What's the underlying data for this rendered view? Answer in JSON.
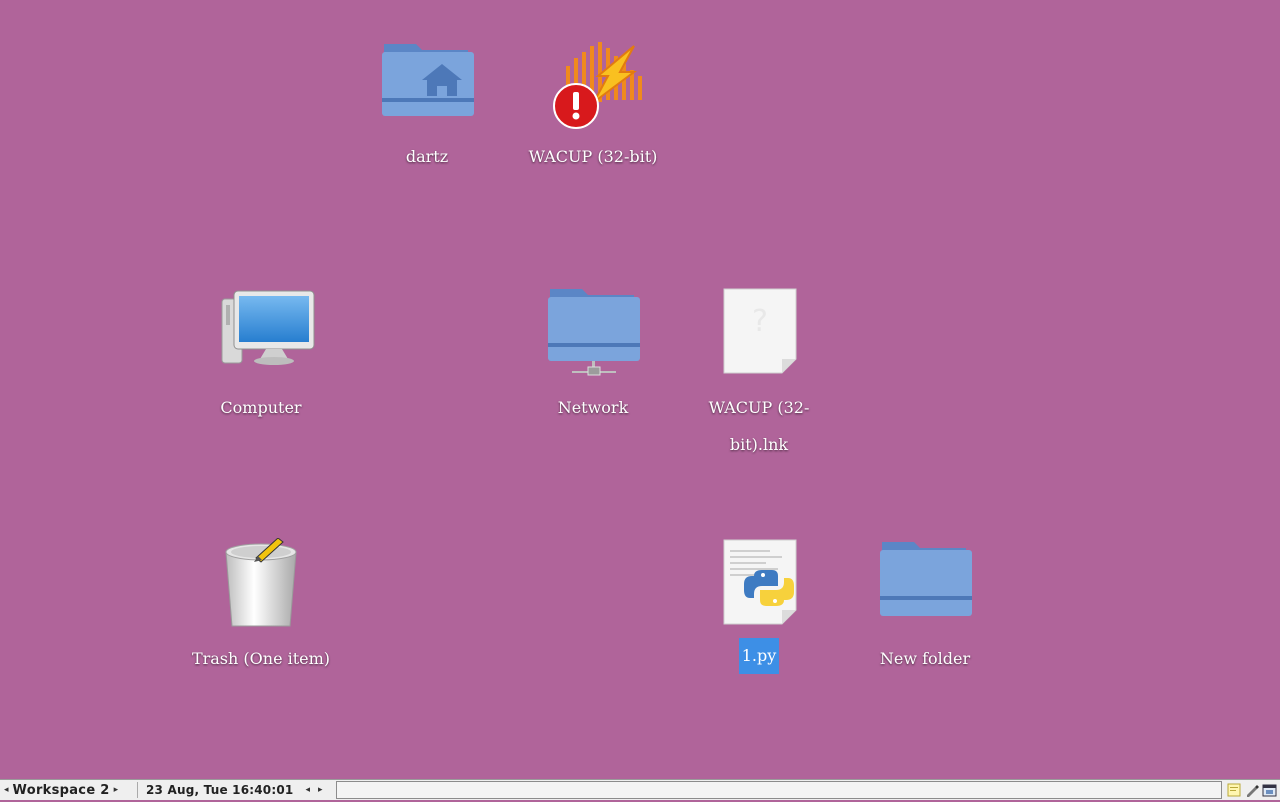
{
  "desktop": {
    "background": "#b0649a",
    "icons": [
      {
        "label": "dartz",
        "icon": "home-folder-icon"
      },
      {
        "label": "WACUP (32-bit)",
        "icon": "wacup-app-icon-with-error-badge"
      },
      {
        "label": "Computer",
        "icon": "computer-icon"
      },
      {
        "label": "Network",
        "icon": "network-folder-icon"
      },
      {
        "label": "WACUP (32-bit).lnk",
        "icon": "unknown-file-icon"
      },
      {
        "label": "Trash (One item)",
        "icon": "trash-full-icon"
      },
      {
        "label": "1.py",
        "icon": "python-file-icon",
        "selected": true
      },
      {
        "label": "New folder",
        "icon": "folder-icon"
      }
    ]
  },
  "taskbar": {
    "workspace": "Workspace 2",
    "clock": "23 Aug, Tue 16:40:01",
    "left_arrow": "◂",
    "right_arrow": "▸",
    "tray_icons": [
      "notes-icon",
      "pen-icon",
      "window-switch-icon"
    ]
  }
}
